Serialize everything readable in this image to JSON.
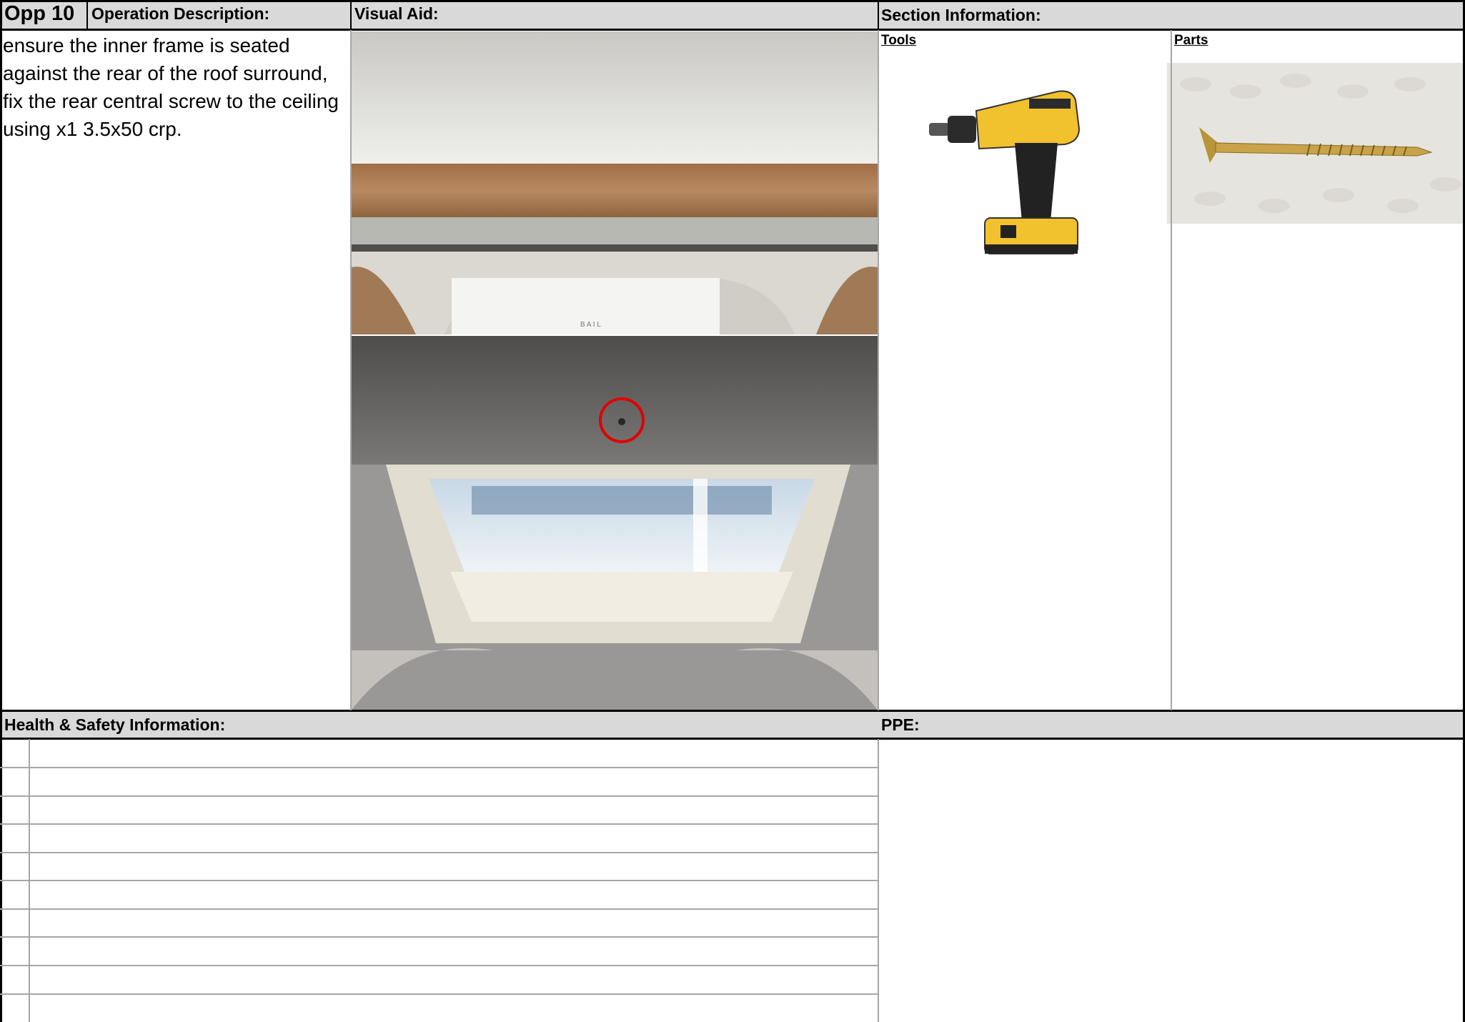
{
  "header": {
    "opp_label": "Opp 10",
    "operation_description_label": "Operation Description:",
    "visual_aid_label": "Visual Aid:",
    "section_information_label": "Section Information:"
  },
  "operation": {
    "description": "ensure the inner frame is seated against the rear of the roof surround, fix the rear central screw to the ceiling using x1 3.5x50 crp."
  },
  "section_info": {
    "tools_label": "Tools",
    "parts_label": "Parts",
    "tool_icon": "cordless-drill",
    "part_icon": "screw"
  },
  "visual_aid": {
    "photo_top_lettering": "B A I L",
    "highlight_color": "#e00000"
  },
  "footer": {
    "health_safety_label": "Health & Safety Information:",
    "ppe_label": "PPE:"
  }
}
